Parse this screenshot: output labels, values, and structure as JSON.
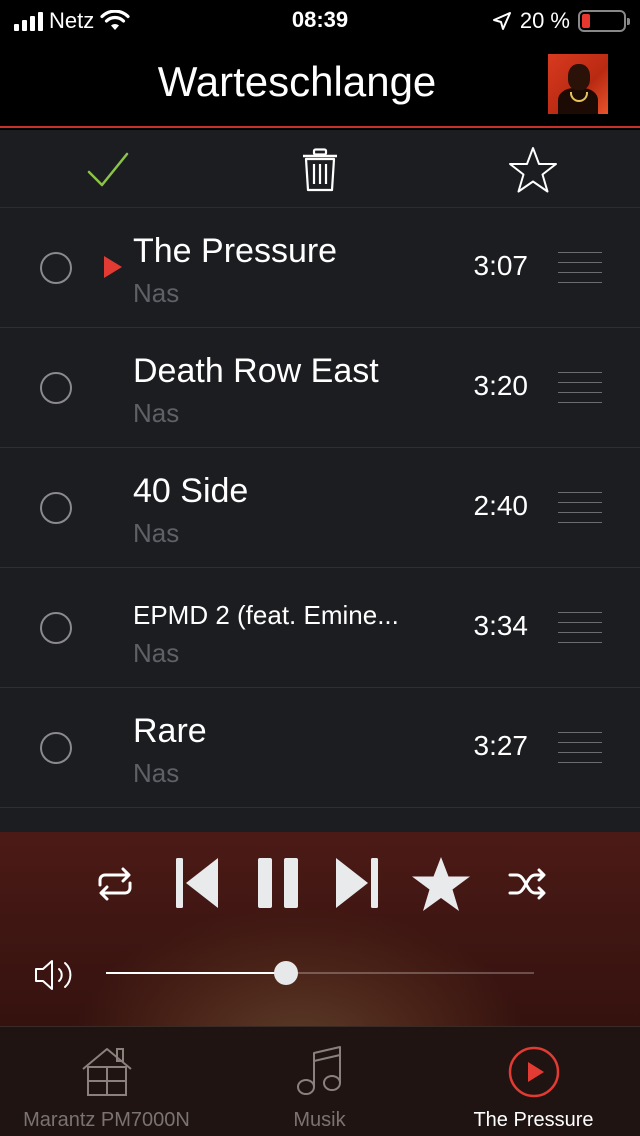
{
  "status_bar": {
    "carrier": "Netz",
    "time": "08:39",
    "battery_percent": "20 %",
    "battery_level": 0.2
  },
  "header": {
    "title": "Warteschlange",
    "cover_icon": "album-cover"
  },
  "toolbar": {
    "icons": [
      "checkmark-icon",
      "trash-icon",
      "star-icon"
    ],
    "check_color": "#8bc34a"
  },
  "queue": [
    {
      "title": "The Pressure",
      "artist": "Nas",
      "duration": "3:07",
      "playing": true
    },
    {
      "title": "Death Row East",
      "artist": "Nas",
      "duration": "3:20",
      "playing": false
    },
    {
      "title": "40 Side",
      "artist": "Nas",
      "duration": "2:40",
      "playing": false
    },
    {
      "title": "EPMD 2 (feat. Emine...",
      "artist": "Nas",
      "duration": "3:34",
      "playing": false
    },
    {
      "title": "Rare",
      "artist": "Nas",
      "duration": "3:27",
      "playing": false
    }
  ],
  "player": {
    "controls": [
      "repeat-icon",
      "previous-icon",
      "pause-icon",
      "next-icon",
      "star-icon",
      "shuffle-icon"
    ],
    "volume_level": 0.42
  },
  "tabs": [
    {
      "label": "Marantz PM7000N",
      "icon": "home-icon",
      "active": false
    },
    {
      "label": "Musik",
      "icon": "music-note-icon",
      "active": false
    },
    {
      "label": "The Pressure",
      "icon": "play-circle-icon",
      "active": true
    }
  ],
  "colors": {
    "accent": "#e23b33",
    "background": "#1c1d21",
    "subtext": "#5f6066"
  }
}
